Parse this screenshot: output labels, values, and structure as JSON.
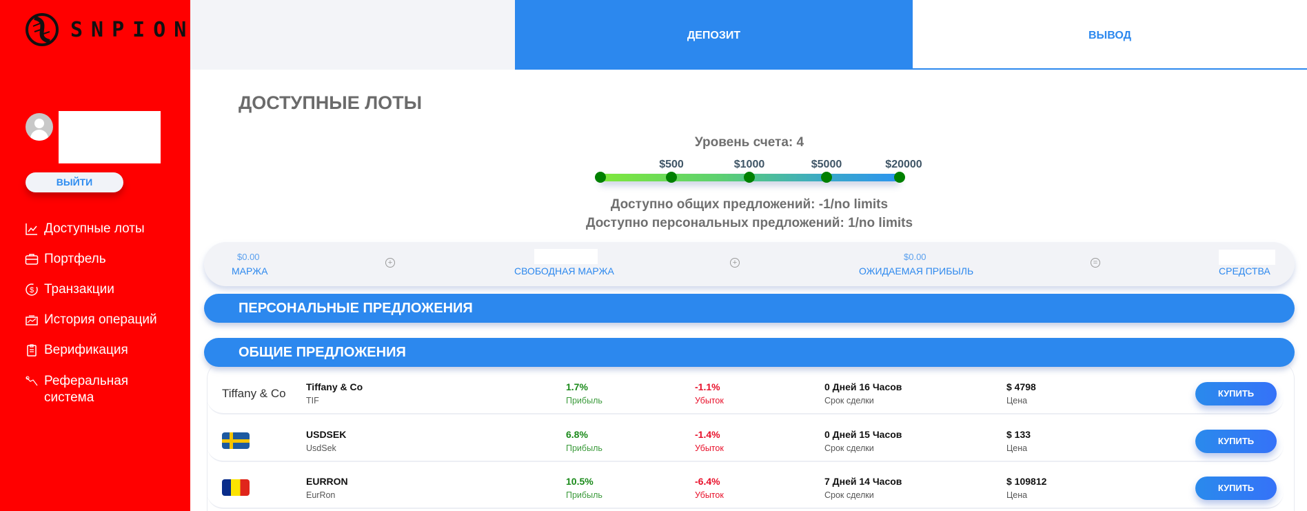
{
  "brand": {
    "name": "SNPION"
  },
  "user": {
    "logout_label": "ВЫЙТИ"
  },
  "sidebar": {
    "items": [
      {
        "label": "Доступные лоты",
        "icon": "chart-line-icon"
      },
      {
        "label": "Портфель",
        "icon": "briefcase-icon"
      },
      {
        "label": "Транзакции",
        "icon": "dollar-cycle-icon"
      },
      {
        "label": "История операций",
        "icon": "history-icon"
      },
      {
        "label": "Верификация",
        "icon": "clipboard-icon"
      },
      {
        "label": "Реферальная система",
        "icon": "referral-icon"
      }
    ]
  },
  "tabs": {
    "deposit": "ДЕПОЗИТ",
    "withdraw": "ВЫВОД"
  },
  "main": {
    "title": "ДОСТУПНЫЕ ЛОТЫ",
    "account_level": "Уровень счета: 4",
    "level_steps": [
      "$500",
      "$1000",
      "$5000",
      "$20000"
    ],
    "level_value": 4,
    "general_available": "Доступно общих предложений: -1/no limits",
    "personal_available": "Доступно персональных предложений: 1/no limits"
  },
  "summary": {
    "margin": {
      "value": "$0.00",
      "label": "МАРЖА"
    },
    "free_margin": {
      "label": "СВОБОДНАЯ МАРЖА"
    },
    "expected_profit": {
      "value": "$0.00",
      "label": "ОЖИДАЕМАЯ ПРИБЫЛЬ"
    },
    "funds": {
      "label": "СРЕДСТВА"
    },
    "ops": [
      "+",
      "+",
      "="
    ]
  },
  "sections": {
    "personal": "ПЕРСОНАЛЬНЫЕ ПРЕДЛОЖЕНИЯ",
    "general": "ОБЩИЕ ПРЕДЛОЖЕНИЯ"
  },
  "labels": {
    "profit": "Прибыль",
    "loss": "Убыток",
    "term": "Срок сделки",
    "price": "Цена",
    "buy": "КУПИТЬ"
  },
  "offers": [
    {
      "logo_alt": "Tiffany & Co",
      "name": "Tiffany & Co",
      "ticker": "TIF",
      "profit": "1.7%",
      "loss": "-1.1%",
      "term": "0 Дней 16 Часов",
      "price": "$ 4798"
    },
    {
      "flag": "sweden",
      "name": "USDSEK",
      "ticker": "UsdSek",
      "profit": "6.8%",
      "loss": "-1.4%",
      "term": "0 Дней 15 Часов",
      "price": "$ 133"
    },
    {
      "flag": "romania",
      "name": "EURRON",
      "ticker": "EurRon",
      "profit": "10.5%",
      "loss": "-6.4%",
      "term": "7 Дней 14 Часов",
      "price": "$ 109812"
    }
  ]
}
